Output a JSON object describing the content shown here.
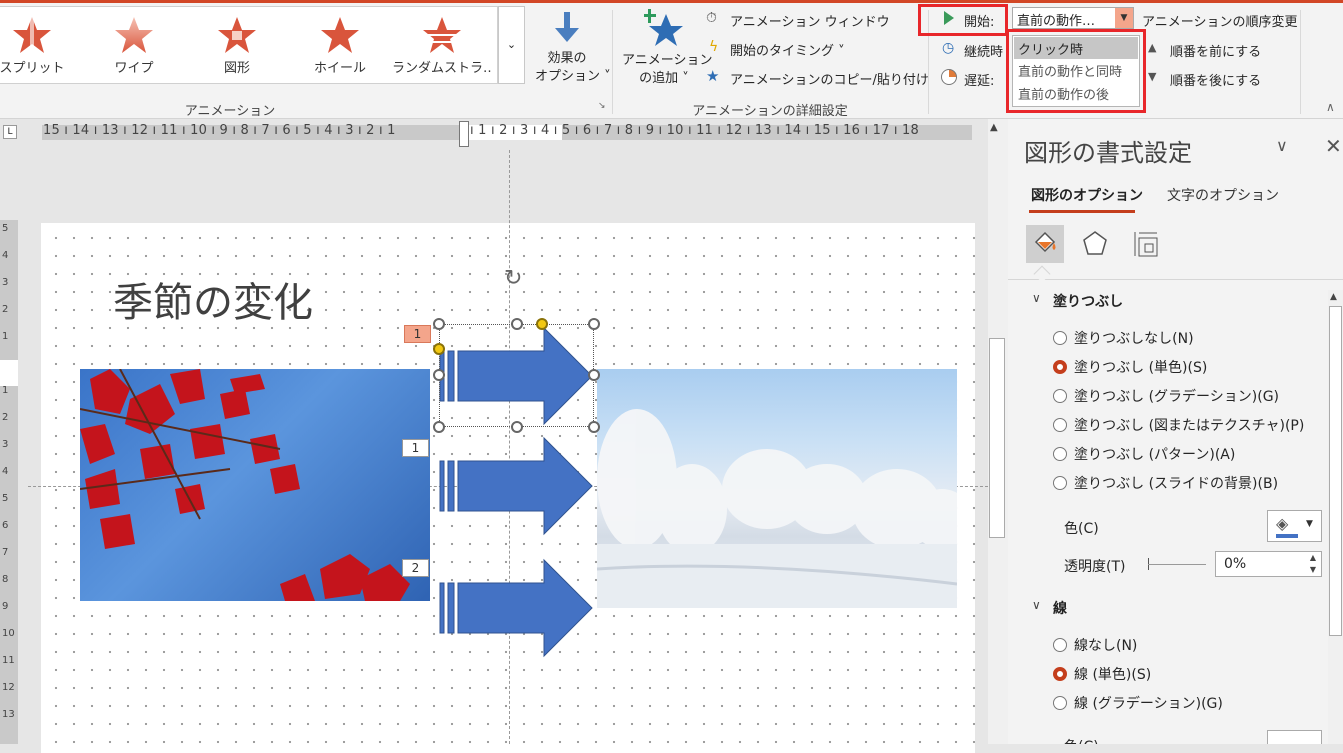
{
  "ribbon": {
    "gallery_items": [
      {
        "label": "スプリット",
        "icon": "split-star-icon"
      },
      {
        "label": "ワイプ",
        "icon": "wipe-star-icon"
      },
      {
        "label": "図形",
        "icon": "shape-star-icon"
      },
      {
        "label": "ホイール",
        "icon": "wheel-star-icon"
      },
      {
        "label": "ランダムストラ…",
        "icon": "random-bars-star-icon"
      }
    ],
    "animation_group": "アニメーション",
    "effect_options": [
      "効果の",
      "オプション ˅"
    ],
    "add_animation": [
      "アニメーション",
      "の追加 ˅"
    ],
    "animation_window": "アニメーション ウィンドウ",
    "start_timing": "開始のタイミング ˅",
    "animation_painter": "アニメーションのコピー/貼り付け",
    "advanced_group": "アニメーションの詳細設定",
    "start_label": "開始:",
    "start_value": "直前の動作…",
    "duration_label": "継続時",
    "delay_label": "遅延:",
    "reorder_title": "アニメーションの順序変更",
    "move_earlier": "順番を前にする",
    "move_later": "順番を後にする",
    "dropdown_options": [
      "クリック時",
      "直前の動作と同時",
      "直前の動作の後"
    ]
  },
  "ruler": {
    "horizontal": "15 ı 14 ı 13 ı 12 ı 11 ı 10 ı 9 ı 8 ı 7 ı 6 ı 5 ı 4 ı 3 ı 2 ı 1",
    "horizontal_right": "ı 1 ı 2 ı 3 ı 4 ı 5 ı 6 ı 7 ı 8 ı 9 ı 10 ı 11 ı 12 ı 13 ı 14 ı 15 ı 16 ı 17 ı 18",
    "vertical": [
      "5",
      "4",
      "3",
      "2",
      "1",
      "",
      "1",
      "2",
      "3",
      "4",
      "5",
      "6",
      "7",
      "8",
      "9",
      "10",
      "11",
      "12",
      "13"
    ]
  },
  "slide": {
    "title": "季節の変化",
    "tags": [
      "1",
      "1",
      "2"
    ]
  },
  "pane": {
    "title": "図形の書式設定",
    "tab_shape": "図形のオプション",
    "tab_text": "文字のオプション",
    "fill_section": "塗りつぶし",
    "fill_options": [
      {
        "label": "塗りつぶしなし(N)",
        "selected": false
      },
      {
        "label": "塗りつぶし (単色)(S)",
        "selected": true
      },
      {
        "label": "塗りつぶし (グラデーション)(G)",
        "selected": false
      },
      {
        "label": "塗りつぶし (図またはテクスチャ)(P)",
        "selected": false
      },
      {
        "label": "塗りつぶし (パターン)(A)",
        "selected": false
      },
      {
        "label": "塗りつぶし (スライドの背景)(B)",
        "selected": false
      }
    ],
    "color_label": "色(C)",
    "transparency_label": "透明度(T)",
    "transparency_value": "0%",
    "line_section": "線",
    "line_options": [
      {
        "label": "線なし(N)",
        "selected": false
      },
      {
        "label": "線 (単色)(S)",
        "selected": true
      },
      {
        "label": "線 (グラデーション)(G)",
        "selected": false
      }
    ],
    "line_color_label": "色(C)"
  },
  "colors": {
    "accent": "#c43e1c",
    "highlight": "#e8262a",
    "arrow": "#4472c4"
  }
}
